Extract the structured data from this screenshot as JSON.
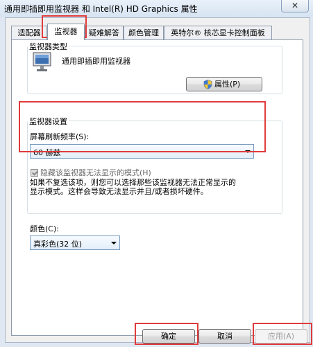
{
  "window": {
    "title": "通用即插即用监视器 和 Intel(R) HD Graphics 属性",
    "close_glyph": "✕"
  },
  "tabs": [
    {
      "label": "适配器"
    },
    {
      "label": "监视器"
    },
    {
      "label": "疑难解答"
    },
    {
      "label": "颜色管理"
    },
    {
      "label": "英特尔® 核芯显卡控制面板"
    }
  ],
  "monitor_type": {
    "group_title": "监视器类型",
    "name": "通用即插即用监视器",
    "properties_label": "属性(P)"
  },
  "monitor_settings": {
    "group_title": "监视器设置",
    "refresh_label": "屏幕刷新频率(S):",
    "refresh_value": "60 赫兹",
    "hide_modes_label": "隐藏该监视器无法显示的模式(H)",
    "hide_modes_checked": true,
    "help_line1": "如果不复选该项，则您可以选择那些该监视器无法正常显示的",
    "help_line2": "显示模式。这样会导致无法显示并且/或者损坏硬件。"
  },
  "colors": {
    "label": "颜色(C):",
    "value": "真彩色(32 位)"
  },
  "footer": {
    "ok_label": "确定",
    "cancel_label": "取消",
    "apply_label": "应用(A)"
  },
  "highlight_color": "#e03b3b"
}
